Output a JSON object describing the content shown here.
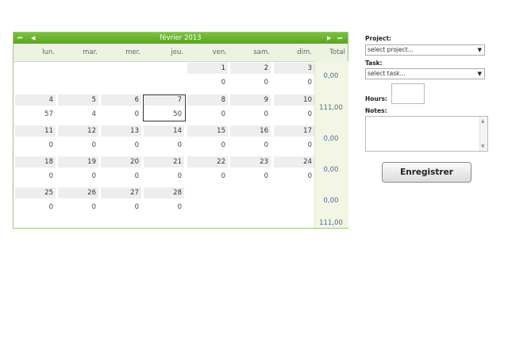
{
  "calendar": {
    "title": "février 2013",
    "nav": {
      "first": "⏮",
      "prev": "◀",
      "next": "▶",
      "last": "⏭"
    },
    "day_names": [
      "lun.",
      "mar.",
      "mer.",
      "jeu.",
      "ven.",
      "sam.",
      "dim."
    ],
    "total_label": "Total",
    "weeks": [
      {
        "dates": [
          "",
          "",
          "",
          "",
          "1",
          "2",
          "3"
        ],
        "hours": [
          "",
          "",
          "",
          "",
          "0",
          "0",
          "0"
        ],
        "total": "0,00"
      },
      {
        "dates": [
          "4",
          "5",
          "6",
          "7",
          "8",
          "9",
          "10"
        ],
        "hours": [
          "57",
          "4",
          "0",
          "50",
          "0",
          "0",
          "0"
        ],
        "total": "111,00"
      },
      {
        "dates": [
          "11",
          "12",
          "13",
          "14",
          "15",
          "16",
          "17"
        ],
        "hours": [
          "0",
          "0",
          "0",
          "0",
          "0",
          "0",
          "0"
        ],
        "total": "0,00"
      },
      {
        "dates": [
          "18",
          "19",
          "20",
          "21",
          "22",
          "23",
          "24"
        ],
        "hours": [
          "0",
          "0",
          "0",
          "0",
          "0",
          "0",
          "0"
        ],
        "total": "0,00"
      },
      {
        "dates": [
          "25",
          "26",
          "27",
          "28",
          "",
          "",
          ""
        ],
        "hours": [
          "0",
          "0",
          "0",
          "0",
          "",
          "",
          ""
        ],
        "total": "0,00"
      }
    ],
    "grand_total": "111,00",
    "selected_date": "7"
  },
  "form": {
    "project_label": "Project:",
    "project_value": "select project...",
    "task_label": "Task:",
    "task_value": "select task...",
    "hours_label": "Hours:",
    "hours_value": "",
    "notes_label": "Notes:",
    "notes_value": "",
    "save_label": "Enregistrer"
  },
  "colors": {
    "header_green": "#6bb32e",
    "total_blue": "#4a6b9e",
    "total_bg": "#f3f6e4"
  }
}
